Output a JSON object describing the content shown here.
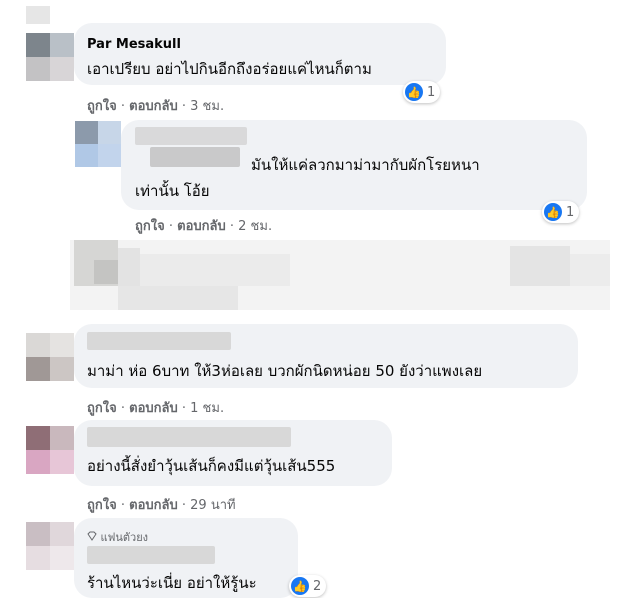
{
  "comments": [
    {
      "author": "Par Mesakull",
      "text": "เอาเปรียบ อย่าไปกินอีกถึงอร่อยแค่ไหนก็ตาม",
      "like_label": "ถูกใจ",
      "reply_label": "ตอบกลับ",
      "time": "3 ชม.",
      "reaction_count": "1",
      "reaction_icon": "like-icon"
    },
    {
      "author": "",
      "text_line1": "มันให้แค่ลวกมาม่ามากับผักโรยหนา",
      "text_line2": "เท่านั้น โอ้ย",
      "like_label": "ถูกใจ",
      "reply_label": "ตอบกลับ",
      "time": "2 ชม.",
      "reaction_count": "1",
      "reaction_icon": "like-icon"
    },
    {
      "author": "",
      "text": "มาม่า ห่อ 6บาท ให้3ห่อเลย บวกผักนิดหน่อย 50 ยังว่าแพงเลย",
      "like_label": "ถูกใจ",
      "reply_label": "ตอบกลับ",
      "time": "1 ชม."
    },
    {
      "author": "",
      "text": "อย่างนี้สั่งยำวุ้นเส้นก็คงมีแต่วุ้นเส้น555",
      "like_label": "ถูกใจ",
      "reply_label": "ตอบกลับ",
      "time": "29 นาที"
    },
    {
      "author": "",
      "badge": "แฟนตัวยง",
      "badge_icon": "diamond-icon",
      "text": "ร้านไหนว่ะเนี่ย อย่าให้รู้นะ",
      "reaction_count": "2",
      "reaction_icon": "like-icon"
    }
  ],
  "separator": "·",
  "colors": {
    "bubble": "#f0f2f5",
    "meta_text": "#65676b",
    "like_blue": "#1877f2"
  }
}
